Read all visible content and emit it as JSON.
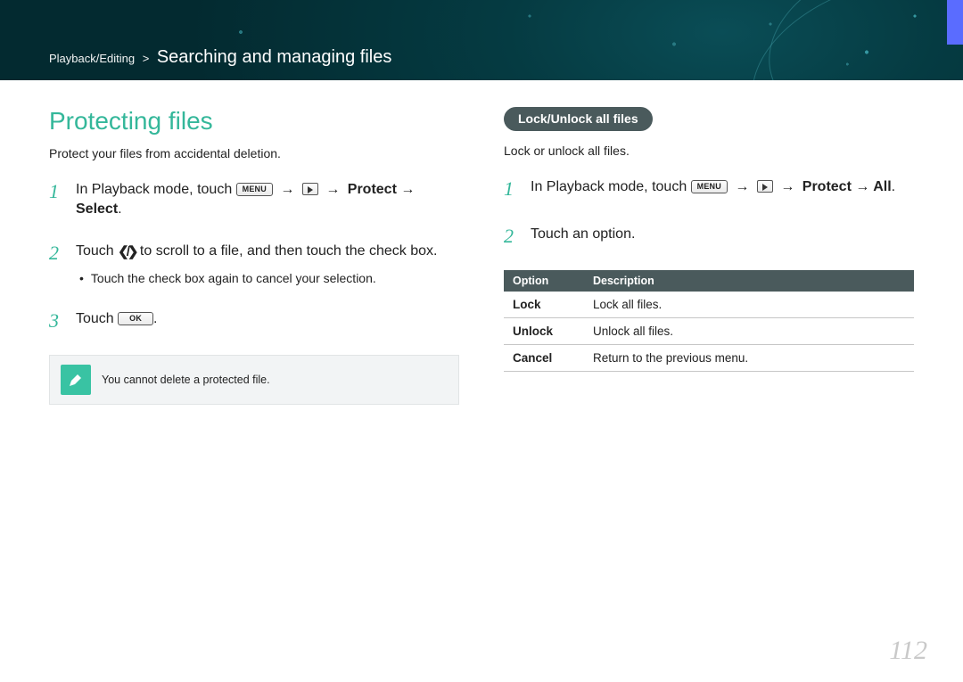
{
  "header": {
    "breadcrumb_small": "Playback/Editing",
    "breadcrumb_sep": ">",
    "breadcrumb_large": "Searching and managing files"
  },
  "left": {
    "title": "Protecting files",
    "intro": "Protect your files from accidental deletion.",
    "steps": [
      {
        "num": "1",
        "pre": "In Playback mode, touch ",
        "btn1": "MENU",
        "arrow": "→",
        "bold_tail": "Protect → Select"
      },
      {
        "num": "2",
        "pre": "Touch ",
        "mid": " to scroll to a file, and then touch the check box.",
        "sub": "Touch the check box again to cancel your selection."
      },
      {
        "num": "3",
        "pre": "Touch ",
        "btn": "OK",
        "post": "."
      }
    ],
    "note": "You cannot delete a protected file."
  },
  "right": {
    "pill": "Lock/Unlock all files",
    "intro": "Lock or unlock all files.",
    "steps": [
      {
        "num": "1",
        "pre": "In Playback mode, touch ",
        "btn1": "MENU",
        "arrow": "→",
        "bold_tail": "Protect → All"
      },
      {
        "num": "2",
        "text": "Touch an option."
      }
    ],
    "table": {
      "head": [
        "Option",
        "Description"
      ],
      "rows": [
        [
          "Lock",
          "Lock all files."
        ],
        [
          "Unlock",
          "Unlock all files."
        ],
        [
          "Cancel",
          "Return to the previous menu."
        ]
      ]
    }
  },
  "page_number": "112"
}
